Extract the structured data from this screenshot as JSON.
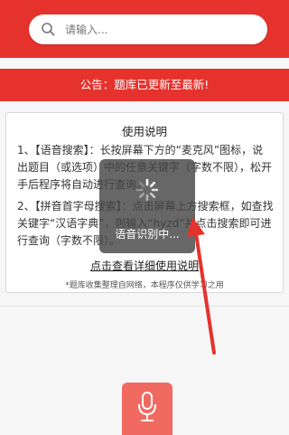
{
  "search": {
    "placeholder": "请输入..."
  },
  "notice": {
    "text": "公告：题库已更新至最新!"
  },
  "instructions": {
    "title": "使用说明",
    "item1": "1、【语音搜索】：长按屏幕下方的“麦克风”图标，说出题目（或选项）中的任意关键字（字数不限），松开手后程序将自动进行查询。",
    "item2": "2、【拼音首字母搜索】：点击屏幕上方搜索框，如查找关键字“汉语字典”，则输入“hyzd”并点击搜索即可进行查询（字数不限）。",
    "link": "点击查看详细使用说明",
    "footnote": "*题库收集整理自网络，本程序仅供学习之用"
  },
  "toast": {
    "text": "语音识别中..."
  },
  "icons": {
    "search": "search-icon",
    "mic": "microphone-icon",
    "spinner": "loading-spinner-icon",
    "arrow": "annotation-arrow"
  },
  "colors": {
    "brand": "#e5322d",
    "mic_button": "#f06a62",
    "toast_bg": "#464646"
  }
}
